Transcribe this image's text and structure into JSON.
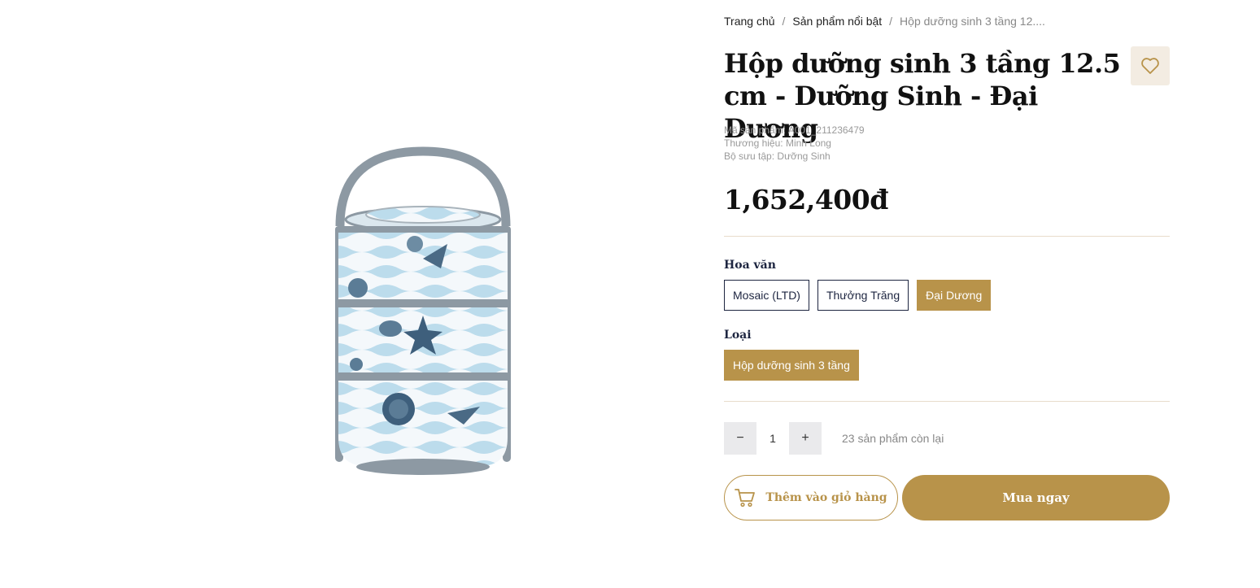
{
  "breadcrumb": {
    "home": "Trang chủ",
    "category": "Sản phẩm nổi bật",
    "current": "Hộp dưỡng sinh 3 tầng 12...."
  },
  "product": {
    "title": "Hộp dưỡng sinh 3 tầng 12.5 cm - Dưỡng Sinh - Đại Dương",
    "sku": "Mã sản phẩm: A001_211236479",
    "brand": "Thương hiệu: Minh Long",
    "collection": "Bộ sưu tập: Dưỡng Sinh",
    "price": "1,652,400đ",
    "image": "lunch-box-product-image"
  },
  "options": {
    "pattern_label": "Hoa văn",
    "patterns": [
      "Mosaic (LTD)",
      "Thưởng Trăng",
      "Đại Dương"
    ],
    "type_label": "Loại",
    "types": [
      "Hộp dưỡng sinh 3 tầng"
    ]
  },
  "quantity": {
    "minus": "−",
    "value": "1",
    "plus": "+",
    "stock": "23 sản phẩm còn lại"
  },
  "actions": {
    "add_to_cart": "Thêm vào giỏ hàng",
    "buy_now": "Mua ngay"
  },
  "icons": {
    "favorite": "heart-icon",
    "cart": "cart-icon"
  },
  "colors": {
    "accent": "#b8934a",
    "navy": "#1d2540",
    "fav_bg": "#f3ece2"
  }
}
